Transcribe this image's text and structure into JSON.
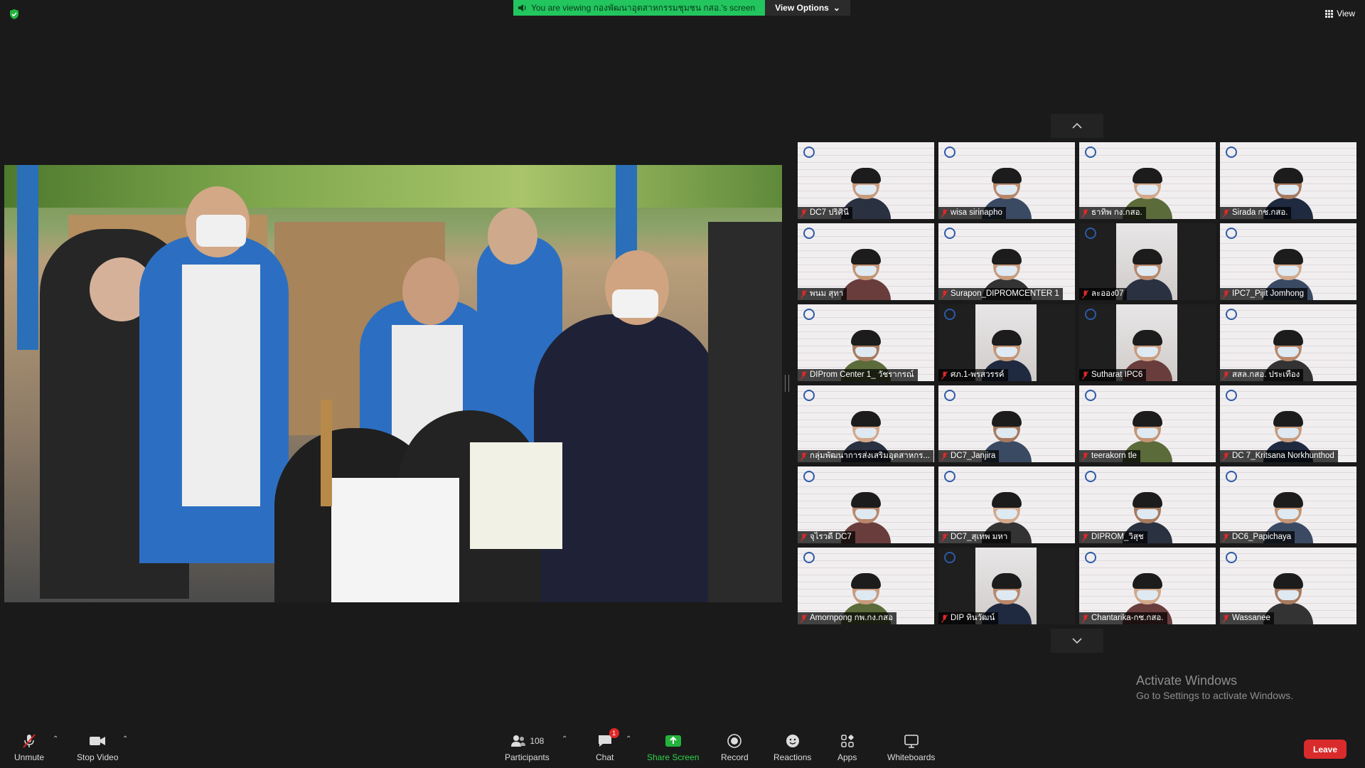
{
  "share_banner": {
    "text": "You are viewing กองพัฒนาอุตสาหกรรมชุมชน กสอ.'s screen"
  },
  "view_options": {
    "label": "View Options"
  },
  "view_button": {
    "label": "View"
  },
  "participants_grid": [
    {
      "name": "DC7 ปริศินี"
    },
    {
      "name": "wisa sirinapho"
    },
    {
      "name": "ธาทิพ กง.กสอ."
    },
    {
      "name": "Sirada กช.กสอ."
    },
    {
      "name": "พนม สุทา"
    },
    {
      "name": "Surapon_DIPROMCENTER 1"
    },
    {
      "name": "ละออง07"
    },
    {
      "name": "IPC7_Pijit Jomhong"
    },
    {
      "name": "DIProm Center 1_ วัชรากรณ์"
    },
    {
      "name": "ศภ.1-พรสวรรค์"
    },
    {
      "name": "Sutharat IPC6"
    },
    {
      "name": "สสล.กสอ. ประเทือง"
    },
    {
      "name": "กลุ่มพัฒนาการส่งเสริมอุตสาหกร..."
    },
    {
      "name": "DC7_Janjira"
    },
    {
      "name": "teerakorn tle"
    },
    {
      "name": "DC 7_Kritsana Norkhunthod"
    },
    {
      "name": "จุไรวดี DC7"
    },
    {
      "name": "DC7_สุเทพ มหา"
    },
    {
      "name": "DIPROM_วิสุช"
    },
    {
      "name": "DC6_Papichaya"
    },
    {
      "name": "Amornpong กพ.กง.กสอ"
    },
    {
      "name": "DIP ทินวัฒน์"
    },
    {
      "name": "Chantarika-กช.กสอ."
    },
    {
      "name": "Wassanee"
    }
  ],
  "watermark": {
    "line1": "Activate Windows",
    "line2": "Go to Settings to activate Windows."
  },
  "toolbar": {
    "unmute": "Unmute",
    "stop_video": "Stop Video",
    "participants": "Participants",
    "participants_count": "108",
    "chat": "Chat",
    "chat_badge": "1",
    "share_screen": "Share Screen",
    "record": "Record",
    "reactions": "Reactions",
    "apps": "Apps",
    "whiteboards": "Whiteboards",
    "leave": "Leave"
  },
  "colors": {
    "share_green": "#22c55e",
    "leave_red": "#d92b2b",
    "background": "#1a1a1a"
  }
}
